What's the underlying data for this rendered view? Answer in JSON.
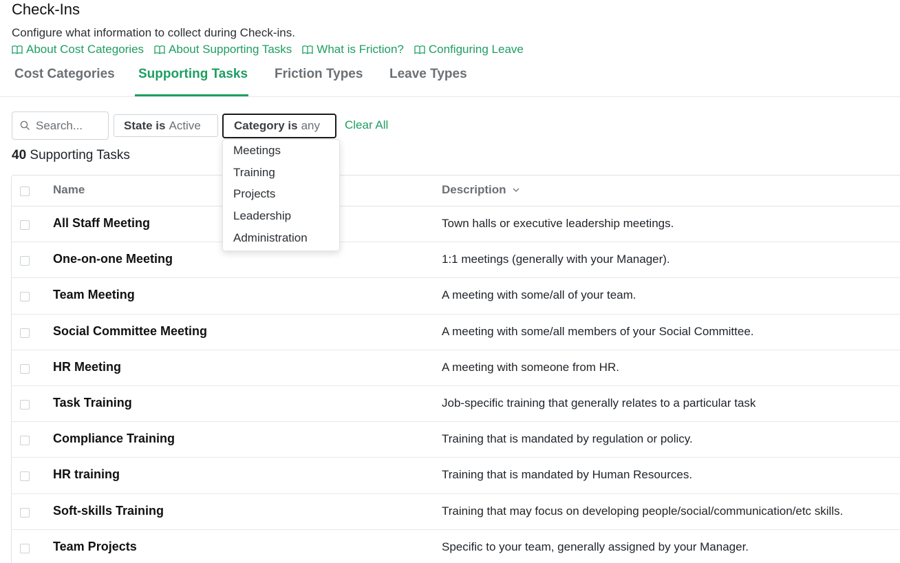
{
  "page": {
    "title": "Check-Ins",
    "subtitle": "Configure what information to collect during Check-ins."
  },
  "links": [
    {
      "label": "About Cost Categories",
      "icon": "book-icon"
    },
    {
      "label": "About Supporting Tasks",
      "icon": "book-icon"
    },
    {
      "label": "What is Friction?",
      "icon": "book-icon"
    },
    {
      "label": "Configuring Leave",
      "icon": "book-icon"
    }
  ],
  "tabs": [
    {
      "label": "Cost Categories",
      "active": false
    },
    {
      "label": "Supporting Tasks",
      "active": true
    },
    {
      "label": "Friction Types",
      "active": false
    },
    {
      "label": "Leave Types",
      "active": false
    }
  ],
  "toolbar": {
    "search_placeholder": "Search...",
    "filters": [
      {
        "key": "State is",
        "value": "Active"
      },
      {
        "key": "Category is",
        "value": "any"
      }
    ],
    "clear_all": "Clear All"
  },
  "category_dropdown": {
    "open": true,
    "options": [
      "Meetings",
      "Training",
      "Projects",
      "Leadership",
      "Administration"
    ]
  },
  "summary": {
    "count": "40",
    "label": "Supporting Tasks"
  },
  "table": {
    "columns": {
      "name": "Name",
      "description": "Description"
    },
    "rows": [
      {
        "name": "All Staff Meeting",
        "description": "Town halls or executive leadership meetings."
      },
      {
        "name": "One-on-one Meeting",
        "description": "1:1 meetings (generally with your Manager)."
      },
      {
        "name": "Team Meeting",
        "description": "A meeting with some/all of your team."
      },
      {
        "name": "Social Committee Meeting",
        "description": "A meeting with some/all members of your Social Committee."
      },
      {
        "name": "HR Meeting",
        "description": "A meeting with someone from HR."
      },
      {
        "name": "Task Training",
        "description": "Job-specific training that generally relates to a particular task"
      },
      {
        "name": "Compliance Training",
        "description": "Training that is mandated by regulation or policy."
      },
      {
        "name": "HR training",
        "description": "Training that is mandated by Human Resources."
      },
      {
        "name": "Soft-skills Training",
        "description": "Training that may focus on developing people/social/communication/etc skills."
      },
      {
        "name": "Team Projects",
        "description": "Specific to your team, generally assigned by your Manager."
      }
    ]
  },
  "colors": {
    "accent": "#1e9e62",
    "muted_text": "#6b7075",
    "border": "#dfe2e5"
  }
}
